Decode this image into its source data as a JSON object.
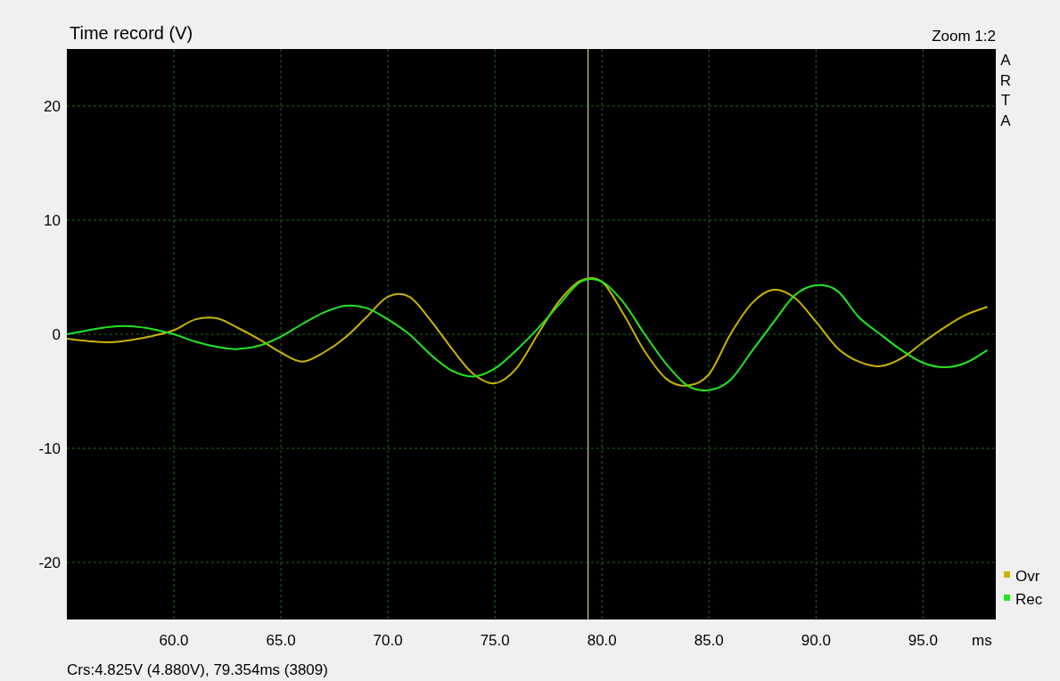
{
  "chart": {
    "title": "Time record (V)",
    "zoom": "Zoom 1:2",
    "brand": "ARTA",
    "chart_data": {
      "type": "line",
      "xlabel": "ms",
      "xlim": [
        55,
        98.4
      ],
      "ylim": [
        -25,
        25
      ],
      "xticks": [
        {
          "value": 60,
          "label": "60.0"
        },
        {
          "value": 65,
          "label": "65.0"
        },
        {
          "value": 70,
          "label": "70.0"
        },
        {
          "value": 75,
          "label": "75.0"
        },
        {
          "value": 80,
          "label": "80.0"
        },
        {
          "value": 85,
          "label": "85.0"
        },
        {
          "value": 90,
          "label": "90.0"
        },
        {
          "value": 95,
          "label": "95.0"
        }
      ],
      "yticks": [
        -20,
        -10,
        0,
        10,
        20
      ],
      "x": [
        55,
        56,
        57,
        58,
        59,
        60,
        61,
        62,
        63,
        64,
        65,
        66,
        67,
        68,
        69,
        70,
        71,
        72,
        73,
        74,
        75,
        76,
        77,
        78,
        79,
        80,
        81,
        82,
        83,
        84,
        85,
        86,
        87,
        88,
        89,
        90,
        91,
        92,
        93,
        94,
        95,
        96,
        97,
        98
      ],
      "series": [
        {
          "name": "Ovr",
          "color": "#c8b400",
          "values": [
            -0.4,
            -0.6,
            -0.7,
            -0.5,
            -0.15,
            0.35,
            1.3,
            1.4,
            0.55,
            -0.45,
            -1.6,
            -2.4,
            -1.6,
            -0.3,
            1.5,
            3.3,
            3.3,
            1.2,
            -1.3,
            -3.5,
            -4.3,
            -3.0,
            0,
            2.9,
            4.7,
            4.6,
            1.8,
            -1.5,
            -3.9,
            -4.5,
            -3.5,
            0,
            2.7,
            3.9,
            3.2,
            1.1,
            -1.2,
            -2.4,
            -2.8,
            -2.1,
            -0.7,
            0.6,
            1.7,
            2.4
          ]
        },
        {
          "name": "Rec",
          "color": "#22e622",
          "values": [
            0,
            0.35,
            0.65,
            0.7,
            0.45,
            0,
            -0.65,
            -1.1,
            -1.3,
            -1.0,
            -0.2,
            0.9,
            1.9,
            2.5,
            2.3,
            1.3,
            0,
            -1.8,
            -3.2,
            -3.7,
            -3.0,
            -1.4,
            0.5,
            2.6,
            4.6,
            4.6,
            2.8,
            0,
            -2.6,
            -4.5,
            -4.9,
            -4.0,
            -1.5,
            1.0,
            3.4,
            4.3,
            3.8,
            1.5,
            0,
            -1.4,
            -2.5,
            -2.9,
            -2.5,
            -1.4
          ]
        }
      ],
      "grid": true,
      "legend": true,
      "ref_lines": [
        {
          "axis": "x",
          "value": 79.354
        }
      ]
    }
  },
  "status_bar": "Crs:4.825V (4.880V), 79.354ms (3809)"
}
